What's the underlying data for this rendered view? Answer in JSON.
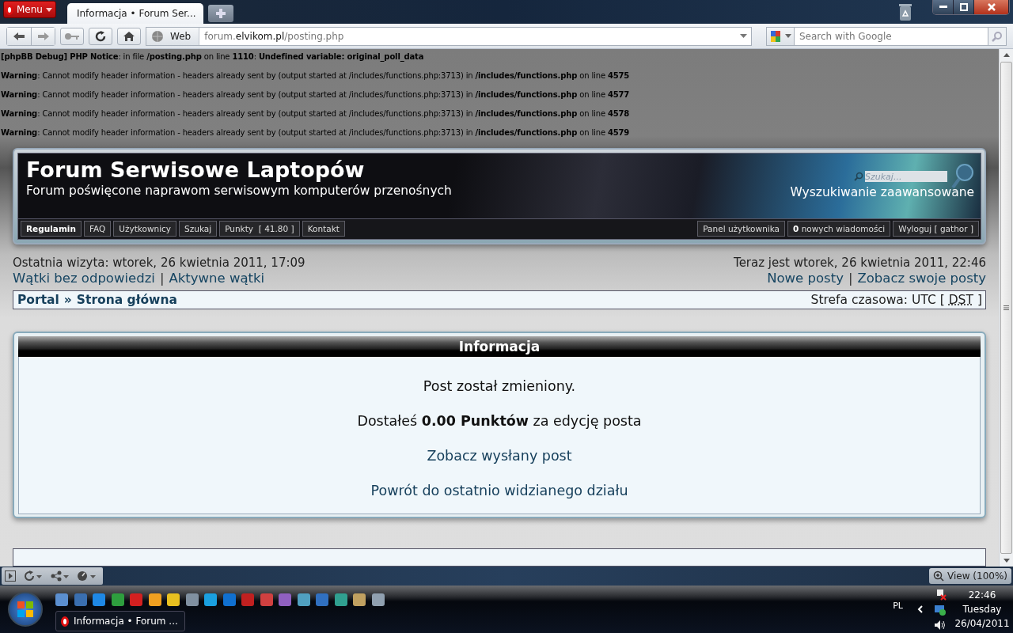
{
  "browser": {
    "menu_label": "Menu",
    "tabs": [
      {
        "title": "Informacja • Forum Ser...",
        "selected": true
      }
    ],
    "address_mode": "Web",
    "url": "forum.**elvikom.pl**/posting.php",
    "search_placeholder": "Search with Google"
  },
  "debug_messages": [
    "**[phpBB Debug] PHP Notice**: in file **/posting.php** on line **1110**: **Undefined variable: original_poll_data**",
    "**Warning**: Cannot modify header information - headers already sent by (output started at /includes/functions.php:3713) in **/includes/functions.php** on line **4575**",
    "**Warning**: Cannot modify header information - headers already sent by (output started at /includes/functions.php:3713) in **/includes/functions.php** on line **4577**",
    "**Warning**: Cannot modify header information - headers already sent by (output started at /includes/functions.php:3713) in **/includes/functions.php** on line **4578**",
    "**Warning**: Cannot modify header information - headers already sent by (output started at /includes/functions.php:3713) in **/includes/functions.php** on line **4579**"
  ],
  "forum_header": {
    "title": "Forum Serwisowe Laptopów",
    "subtitle": "Forum poświęcone naprawom serwisowym komputerów przenośnych",
    "search_placeholder": "Szukaj...",
    "advanced_search": "Wyszukiwanie zaawansowane",
    "nav_left": [
      {
        "label": "Regulamin",
        "selected": true
      },
      {
        "label": "FAQ",
        "selected": false
      },
      {
        "label": "Użytkownicy",
        "selected": false
      },
      {
        "label": "Szukaj",
        "selected": false
      },
      {
        "label": "Punkty  [ 41.80 ]",
        "selected": false
      },
      {
        "label": "Kontakt",
        "selected": false
      }
    ],
    "nav_right": [
      "Panel użytkownika",
      "**0** nowych wiadomości",
      "Wyloguj [ gathor ]"
    ]
  },
  "last_visit": "Ostatnia wizyta: wtorek, 26 kwietnia 2011, 17:09",
  "current_time": "Teraz jest wtorek, 26 kwietnia 2011, 22:46",
  "links_left": [
    "Wątki bez odpowiedzi",
    "Aktywne wątki"
  ],
  "links_right": [
    "Nowe posty",
    "Zobacz swoje posty"
  ],
  "link_separator": "|",
  "breadcrumb": {
    "items": [
      "Portal",
      "Strona główna"
    ],
    "separator": "»",
    "timezone": "Strefa czasowa: UTC [",
    "dst": "DST",
    "timezone_end": "]"
  },
  "info_box": {
    "title": "Informacja",
    "lines": [
      {
        "kind": "text",
        "text": "Post został zmieniony."
      },
      {
        "kind": "text",
        "text": "Dostałeś **0.00 Punktów** za edycję posta"
      },
      {
        "kind": "link",
        "text": "Zobacz wysłany post"
      },
      {
        "kind": "link",
        "text": "Powrót do ostatnio widzianego działu"
      }
    ]
  },
  "status_bar": {
    "view": "View (100%)"
  },
  "taskbar": {
    "window_button": "Informacja • Forum ...",
    "language": "PL",
    "time": "22:46",
    "day": "Tuesday",
    "date": "26/04/2011"
  }
}
